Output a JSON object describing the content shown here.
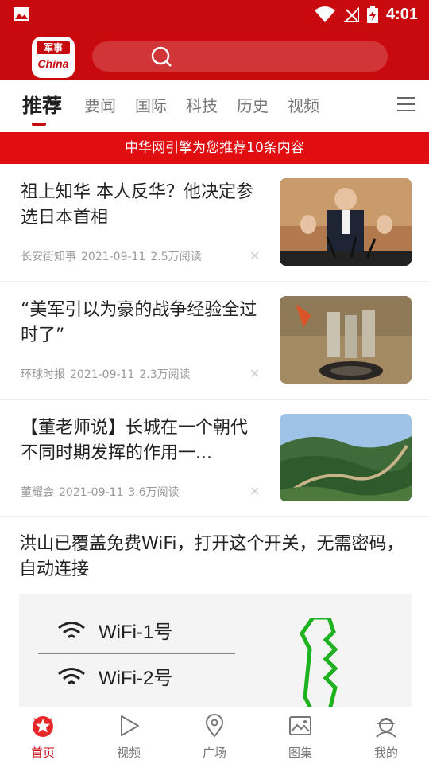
{
  "status_bar": {
    "time": "4:01"
  },
  "header": {
    "logo_top": "军事",
    "logo_bottom": "China"
  },
  "tabs": [
    {
      "label": "推荐",
      "active": true
    },
    {
      "label": "要闻"
    },
    {
      "label": "国际"
    },
    {
      "label": "科技"
    },
    {
      "label": "历史"
    },
    {
      "label": "视频"
    }
  ],
  "banner": {
    "text": "中华网引擎为您推荐10条内容"
  },
  "feed": [
    {
      "title": "祖上知华 本人反华？他决定参选日本首相",
      "source": "长安街知事",
      "date": "2021-09-11",
      "reads": "2.5万阅读"
    },
    {
      "title": "“美军引以为豪的战争经验全过时了”",
      "source": "环球时报",
      "date": "2021-09-11",
      "reads": "2.3万阅读"
    },
    {
      "title": "【董老师说】长城在一个朝代不同时期发挥的作用一...",
      "source": "董耀会",
      "date": "2021-09-11",
      "reads": "3.6万阅读"
    }
  ],
  "ad": {
    "title": "洪山已覆盖免费WiFi，打开这个开关，无需密码，自动连接",
    "wifi_1": "WiFi-1号",
    "wifi_2": "WiFi-2号"
  },
  "bottom_nav": [
    {
      "label": "首页",
      "icon": "home-star-icon",
      "active": true
    },
    {
      "label": "视频",
      "icon": "play-icon"
    },
    {
      "label": "广场",
      "icon": "location-pin-icon"
    },
    {
      "label": "图集",
      "icon": "image-icon"
    },
    {
      "label": "我的",
      "icon": "soldier-avatar-icon"
    }
  ],
  "colors": {
    "brand_red": "#c8090d",
    "banner_red": "#e00d11"
  }
}
